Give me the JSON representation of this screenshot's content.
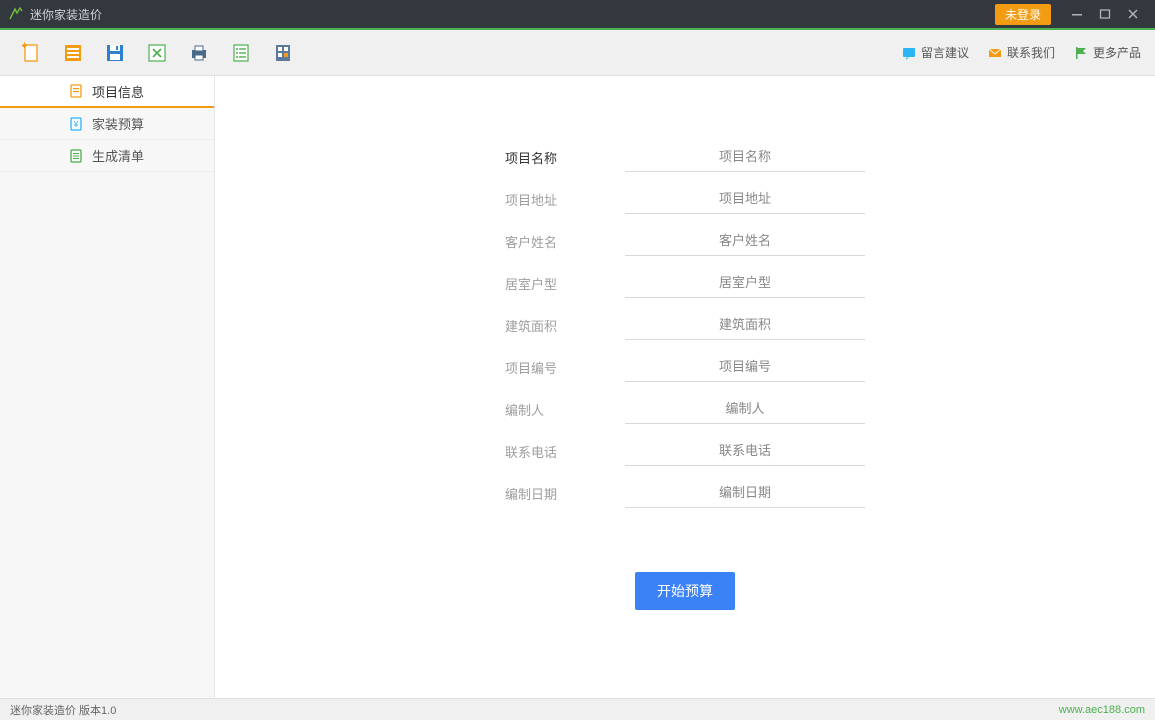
{
  "titlebar": {
    "app_name": "迷你家装造价",
    "login_badge": "未登录"
  },
  "toolbar": {
    "links": {
      "feedback": "留言建议",
      "contact": "联系我们",
      "more": "更多产品"
    }
  },
  "sidebar": {
    "items": [
      {
        "label": "项目信息",
        "active": true
      },
      {
        "label": "家装预算",
        "active": false
      },
      {
        "label": "生成清单",
        "active": false
      }
    ]
  },
  "form": {
    "rows": [
      {
        "label": "项目名称",
        "placeholder": "项目名称",
        "active": true
      },
      {
        "label": "项目地址",
        "placeholder": "项目地址",
        "active": false
      },
      {
        "label": "客户姓名",
        "placeholder": "客户姓名",
        "active": false
      },
      {
        "label": "居室户型",
        "placeholder": "居室户型",
        "active": false
      },
      {
        "label": "建筑面积",
        "placeholder": "建筑面积",
        "active": false
      },
      {
        "label": "项目编号",
        "placeholder": "项目编号",
        "active": false
      },
      {
        "label": "编制人",
        "placeholder": "编制人",
        "active": false
      },
      {
        "label": "联系电话",
        "placeholder": "联系电话",
        "active": false
      },
      {
        "label": "编制日期",
        "placeholder": "编制日期",
        "active": false
      }
    ],
    "start_button": "开始预算"
  },
  "statusbar": {
    "app_version": "迷你家装造价  版本1.0",
    "url": "www.aec188.com"
  },
  "icons": {
    "new": "new-file-icon",
    "open": "open-folder-icon",
    "save": "save-icon",
    "export_excel": "excel-icon",
    "print": "print-icon",
    "list": "list-icon",
    "calc": "calculator-icon"
  }
}
